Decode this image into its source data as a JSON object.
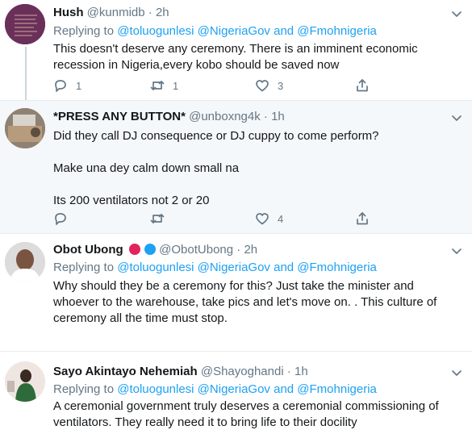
{
  "tweets": [
    {
      "name": "Hush",
      "handle": "@kunmidb",
      "time": "· 2h",
      "replying_prefix": "Replying to",
      "replying_to": "@toluogunlesi @NigeriaGov and @Fmohnigeria",
      "text_lines": [
        "This doesn't deserve any ceremony. There is an imminent economic recession in Nigeria,every kobo should be saved now"
      ],
      "replies": "1",
      "retweets": "1",
      "likes": "3"
    },
    {
      "name": "*PRESS ANY BUTTON*",
      "handle": "@unboxng4k",
      "time": "· 1h",
      "text_lines": [
        "Did they call DJ consequence or DJ cuppy to come perform?",
        "Make una dey calm down small na",
        "Its 200 ventilators not 2 or 20"
      ],
      "replies": "",
      "retweets": "",
      "likes": "4"
    },
    {
      "name": "Obot Ubong",
      "handle": "@ObotUbong",
      "time": "· 2h",
      "replying_prefix": "Replying to",
      "replying_to": "@toluogunlesi @NigeriaGov and @Fmohnigeria",
      "text_lines": [
        "Why should they be a ceremony for this? Just take the minister and whoever to the warehouse, take pics and let's move on. . This culture of ceremony all the time must stop."
      ],
      "badge_colors": [
        "#e0245e",
        "#1da1f2"
      ]
    },
    {
      "name": "Sayo Akintayo Nehemiah",
      "handle": "@Shayoghandi",
      "time": "· 1h",
      "replying_prefix": "Replying to",
      "replying_to": "@toluogunlesi @NigeriaGov and @Fmohnigeria",
      "text_lines": [
        "A ceremonial government truly deserves a  ceremonial commissioning of ventilators. They really need it to bring life to their docility"
      ]
    }
  ],
  "icons": [
    "reply-icon",
    "retweet-icon",
    "like-icon",
    "share-icon",
    "caret-down-icon"
  ],
  "colors": {
    "link": "#1da1f2",
    "muted": "#657786",
    "highlight_bg": "#f5f8fa",
    "divider": "#e6ecf0"
  }
}
